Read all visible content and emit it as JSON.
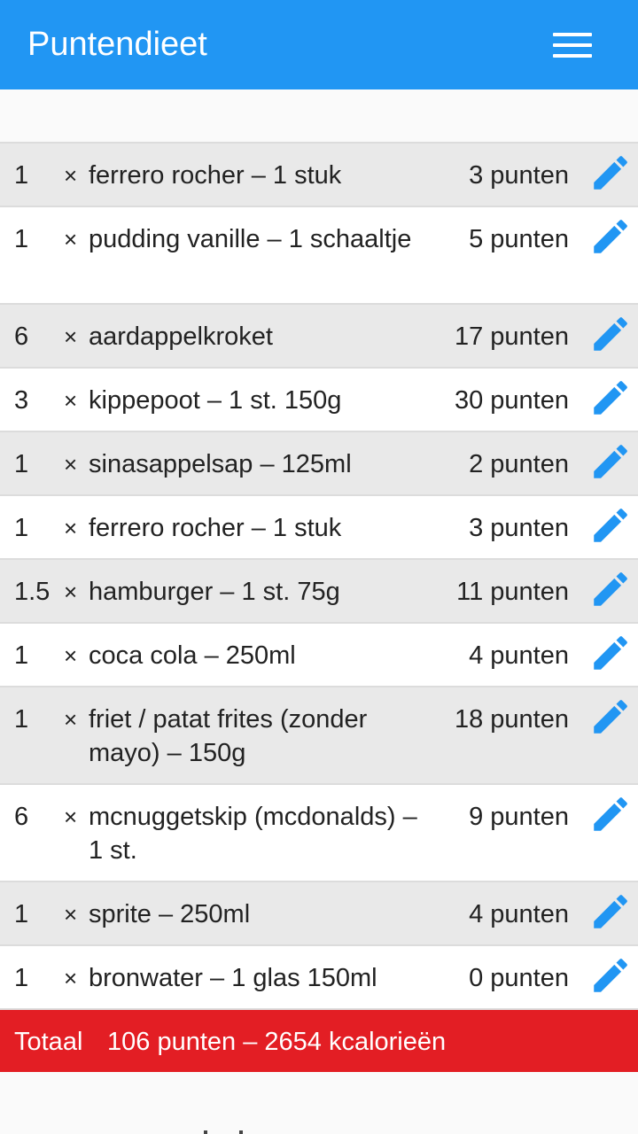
{
  "app": {
    "title": "Puntendieet",
    "menu_icon": "hamburger-menu-icon"
  },
  "colors": {
    "appbar": "#2196f3",
    "total_bar": "#e31e24",
    "edit_icon": "#2196f3",
    "row_alt": "#e9e9e9"
  },
  "entries": [
    {
      "qty": "1",
      "times": "×",
      "name": "ferrero rocher – 1 stuk",
      "points": "3 punten"
    },
    {
      "qty": "1",
      "times": "×",
      "name": "pudding vanille – 1 schaaltje",
      "points": "5 punten"
    },
    {
      "qty": "6",
      "times": "×",
      "name": "aardappelkroket",
      "points": "17 punten"
    },
    {
      "qty": "3",
      "times": "×",
      "name": "kippepoot – 1 st. 150g",
      "points": "30 punten"
    },
    {
      "qty": "1",
      "times": "×",
      "name": "sinasappelsap – 125ml",
      "points": "2 punten"
    },
    {
      "qty": "1",
      "times": "×",
      "name": "ferrero rocher – 1 stuk",
      "points": "3 punten"
    },
    {
      "qty": "1.5",
      "times": "×",
      "name": "hamburger – 1 st. 75g",
      "points": "11 punten"
    },
    {
      "qty": "1",
      "times": "×",
      "name": "coca cola – 250ml",
      "points": "4 punten"
    },
    {
      "qty": "1",
      "times": "×",
      "name": "friet / patat frites (zonder mayo) – 150g",
      "points": "18 punten"
    },
    {
      "qty": "6",
      "times": "×",
      "name": "mcnuggetskip (mcdonalds) – 1 st.",
      "points": "9 punten"
    },
    {
      "qty": "1",
      "times": "×",
      "name": "sprite – 250ml",
      "points": "4 punten"
    },
    {
      "qty": "1",
      "times": "×",
      "name": "bronwater – 1 glas 150ml",
      "points": "0 punten"
    }
  ],
  "total": {
    "label": "Totaal",
    "value": "106 punten – 2654 kcalorieën"
  }
}
